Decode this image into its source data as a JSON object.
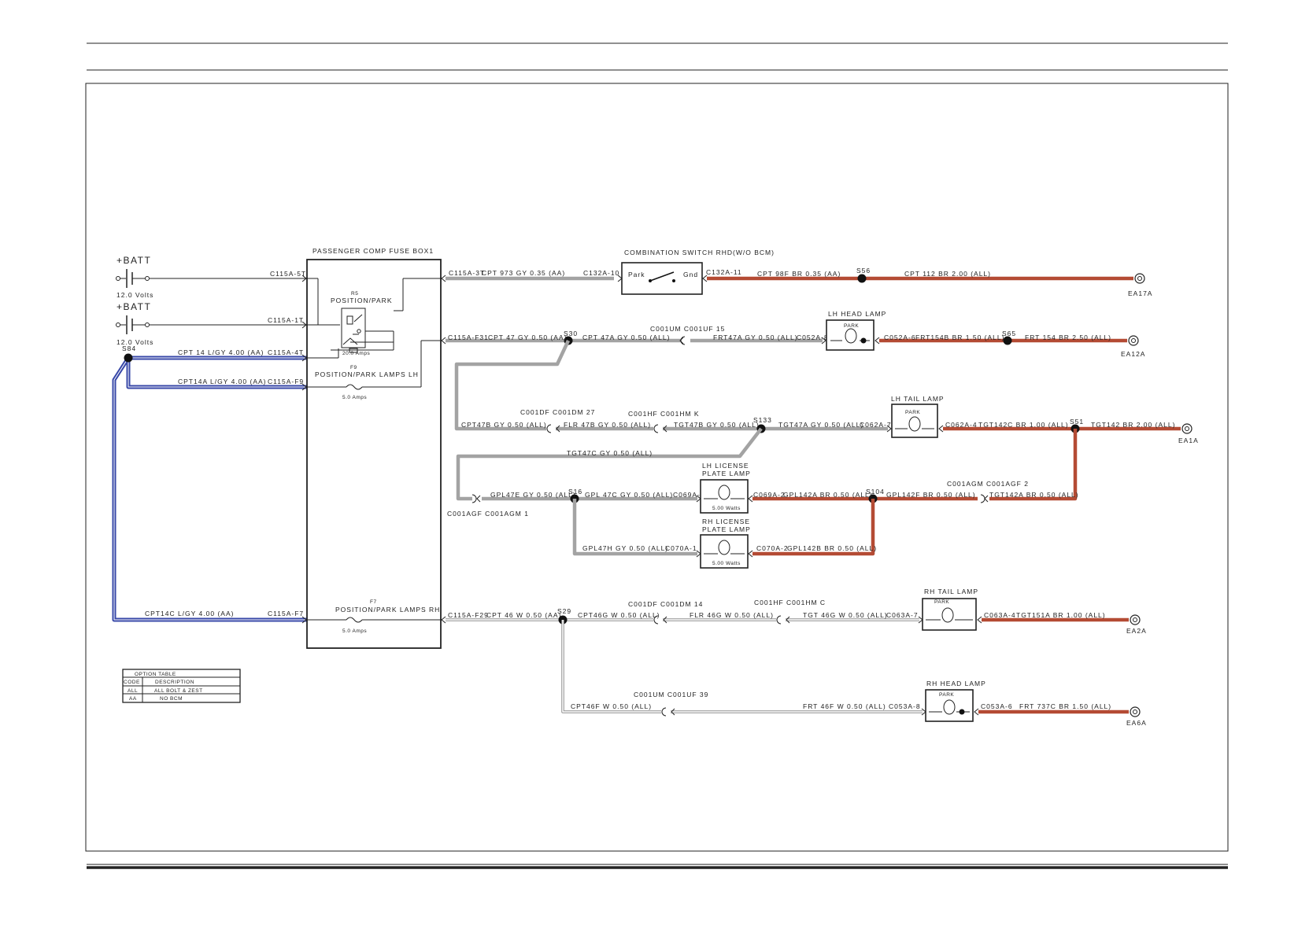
{
  "colors": {
    "wire_gy": "#a3a3a3",
    "wire_br": "#b44b34",
    "wire_bl": "#3848a8",
    "wire_w": "#ffffff",
    "frame": "#222222"
  },
  "power": {
    "batt1": {
      "label": "+BATT",
      "volts": "12.0 Volts"
    },
    "batt2": {
      "label": "+BATT",
      "volts": "12.0 Volts"
    }
  },
  "fusebox": {
    "title": "PASSENGER COMP FUSE BOX1",
    "relay_name": "R5",
    "relay_desc": "POSITION/PARK",
    "relay_fuse_amps": "20.0 Amps",
    "f9_name": "F9",
    "f9_desc": "POSITION/PARK LAMPS LH",
    "f9_amps": "5.0 Amps",
    "f7_name": "F7",
    "f7_desc": "POSITION/PARK LAMPS RH",
    "f7_amps": "5.0 Amps"
  },
  "components": {
    "combo_switch": "COMBINATION SWITCH RHD(W/O BCM)",
    "combo_park": "Park",
    "combo_gnd": "Gnd",
    "lh_head_lamp": "LH HEAD LAMP",
    "lh_tail_lamp": "LH TAIL LAMP",
    "lh_license_1": "LH LICENSE",
    "lh_license_2": "PLATE LAMP",
    "rh_license_1": "RH LICENSE",
    "rh_license_2": "PLATE LAMP",
    "rh_tail_lamp": "RH TAIL LAMP",
    "rh_head_lamp": "RH HEAD LAMP",
    "park": "PARK",
    "watts": "5.00 Watts"
  },
  "connectors": {
    "c115a_5t": "C115A-5T",
    "c115a_1t": "C115A-1T",
    "c115a_4t": "C115A-4T",
    "c115a_f9": "C115A-F9",
    "c115a_f7": "C115A-F7",
    "c115a_3t": "C115A-3T",
    "c115a_f31": "C115A-F31",
    "c115a_f29": "C115A-F29",
    "c132a_10": "C132A-10",
    "c132a_11": "C132A-11",
    "c001um_1": "C001UM C001UF 15",
    "c052a_8": "C052A-8",
    "c052a_6": "C052A-6",
    "c001df_1": "C001DF C001DM 27",
    "c001hf_1": "C001HF C001HM K",
    "c062a_7": "C062A-7",
    "c062a_4": "C062A-4",
    "c001agf": "C001AGF C001AGM 1",
    "c069a_1": "C069A-1",
    "c069a_2": "C069A-2",
    "c001agm": "C001AGM C001AGF 2",
    "c070a_1": "C070A-1",
    "c070a_2": "C070A-2",
    "c001df_2": "C001DF C001DM 14",
    "c001hf_2": "C001HF C001HM C",
    "c063a_7": "C063A-7",
    "c063a_4": "C063A-4",
    "c001um_2": "C001UM C001UF 39",
    "c053a_8": "C053A-8",
    "c053a_6": "C053A-6"
  },
  "splices": {
    "s84": "S84",
    "s30": "S30",
    "s56": "S56",
    "s65": "S65",
    "s133": "S133",
    "s51": "S51",
    "s16": "S16",
    "s104": "S104",
    "s29": "S29"
  },
  "grounds": {
    "ea17a": "EA17A",
    "ea12a": "EA12A",
    "ea1a": "EA1A",
    "ea2a": "EA2A",
    "ea6a": "EA6A"
  },
  "wires": {
    "cpt14": "CPT 14 L/GY 4.00 (AA)",
    "cpt14a": "CPT14A L/GY 4.00 (AA)",
    "cpt14c": "CPT14C L/GY 4.00 (AA)",
    "cpt973": "CPT 973 GY 0.35 (AA)",
    "cpt98f": "CPT  98F BR 0.35 (AA)",
    "cpt112": "CPT  112 BR 2.00 (ALL)",
    "cpt47": "CPT 47 GY 0.50 (AA)",
    "cpt47a": "CPT  47A GY 0.50 (ALL)",
    "frt47a": "FRT47A GY 0.50 (ALL)",
    "frt154b": "FRT154B BR 1.50 (ALL)",
    "frt154": "FRT 154 BR 2.50 (ALL)",
    "cpt47b": "CPT47B GY 0.50 (ALL)",
    "flr47b": "FLR 47B GY 0.50 (ALL)",
    "tgt47b": "TGT47B GY 0.50 (ALL)",
    "tgt47a": "TGT47A GY 0.50 (ALL)",
    "tgt142c": "TGT142C BR 1.00 (ALL)",
    "tgt142": "TGT142 BR 2.00 (ALL)",
    "tgt47c": "TGT47C GY 0.50 (ALL)",
    "gpl47e": "GPL47E GY 0.50 (ALL)",
    "gpl47c": "GPL 47C GY 0.50 (ALL)",
    "gpl142a": "GPL142A BR 0.50 (ALL)",
    "gpl142f": "GPL142F BR 0.50 (ALL)",
    "tgt142a": "TGT142A BR 0.50 (ALL)",
    "gpl47h": "GPL47H GY 0.50 (ALL)",
    "gpl142b": "GPL142B BR 0.50 (ALL)",
    "cpt46": "CPT 46 W 0.50 (AA)",
    "cpt46g": "CPT46G W 0.50 (ALL)",
    "flr46g": "FLR 46G W 0.50 (ALL)",
    "tgt46g": "TGT 46G W 0.50 (ALL)",
    "tgt151a": "TGT151A BR 1.00 (ALL)",
    "cpt46f": "CPT46F W 0.50 (ALL)",
    "frt46f": "FRT 46F W 0.50 (ALL)",
    "frt737c": "FRT 737C BR 1.50 (ALL)"
  },
  "option_table": {
    "title": "OPTION TABLE",
    "rows": [
      {
        "code": "CODE",
        "desc": "DESCRIPTION"
      },
      {
        "code": "ALL",
        "desc": "ALL BOLT & ZEST"
      },
      {
        "code": "AA",
        "desc": "NO BCM"
      }
    ]
  }
}
